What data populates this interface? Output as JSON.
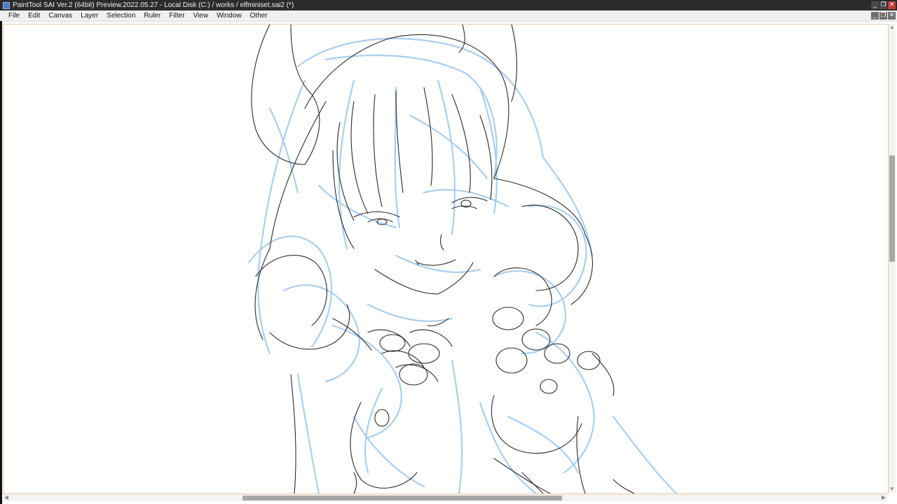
{
  "window": {
    "title": "PaintTool SAI Ver.2 (64bit) Preview.2022.05.27 - Local Disk (C:) / works / elfminiset.sai2 (*)",
    "controls": {
      "minimize": "_",
      "restore": "❐",
      "close": "✕"
    }
  },
  "menubar": {
    "items": [
      "File",
      "Edit",
      "Canvas",
      "Layer",
      "Selection",
      "Ruler",
      "Filter",
      "View",
      "Window",
      "Other"
    ]
  },
  "document": {
    "controls": {
      "minimize": "_",
      "restore": "❐",
      "close": "✕"
    },
    "canvas_content": "sketch-artwork"
  },
  "scrollbars": {
    "vertical": {
      "up": "▲",
      "down": "▼"
    },
    "horizontal": {
      "left": "◀",
      "right": "▶"
    }
  },
  "colors": {
    "titlebar": "#2b2b2b",
    "sketch_blue": "#9cc6ec",
    "sketch_line": "#2a2a2a",
    "close_red": "#c83a3a"
  }
}
